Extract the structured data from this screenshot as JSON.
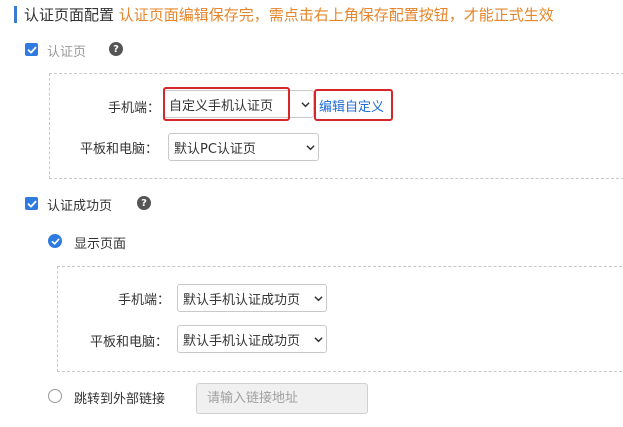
{
  "header": {
    "title": "认证页面配置",
    "note": "认证页面编辑保存完，需点击右上角保存配置按钮，才能正式生效"
  },
  "auth_page": {
    "label": "认证页",
    "checked": true,
    "mobile_label": "手机端：",
    "mobile_value": "自定义手机认证页",
    "edit_link": "编辑自定义",
    "tablet_label": "平板和电脑：",
    "tablet_value": "默认PC认证页"
  },
  "success_page": {
    "label": "认证成功页",
    "checked": true,
    "show_page_label": "显示页面",
    "mobile_label": "手机端：",
    "mobile_value": "默认手机认证成功页",
    "tablet_label": "平板和电脑：",
    "tablet_value": "默认手机认证成功页",
    "redirect_label": "跳转到外部链接",
    "link_placeholder": "请输入链接地址"
  },
  "colors": {
    "accent": "#2f7be0",
    "note": "#e6852a",
    "highlight": "#d6262c",
    "link": "#1e6bd6"
  },
  "icons": [
    "check-icon",
    "help-icon",
    "chevron-down-icon"
  ]
}
